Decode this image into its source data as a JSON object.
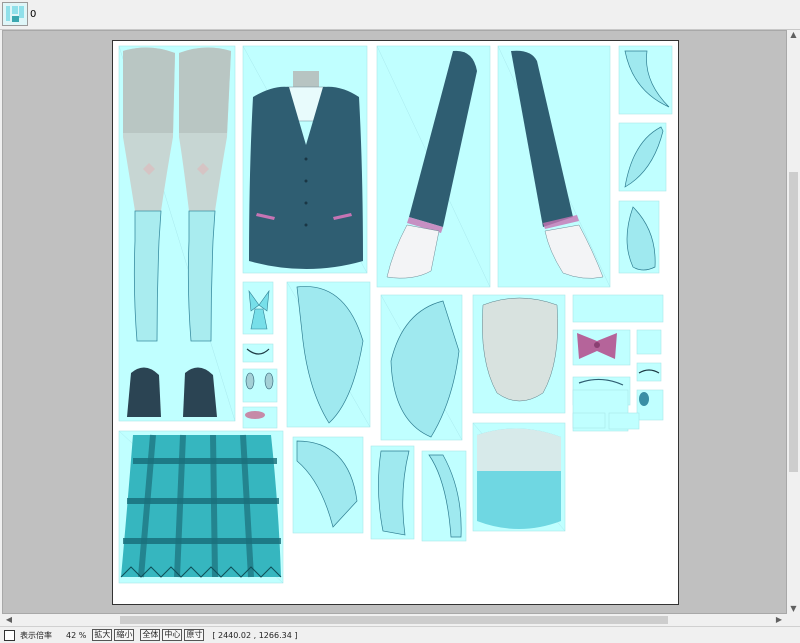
{
  "tab": {
    "label": "0"
  },
  "status": {
    "zoom_label": "表示倍率",
    "zoom_value": "42 %",
    "zoom_in": "拡大",
    "zoom_out": "縮小",
    "fit_all": "全体",
    "center": "中心",
    "actual_size": "原寸",
    "coords": "[ 2440.02 , 1266.34 ]"
  },
  "colors": {
    "panel": "#c0ffff",
    "jacket": "#2f5e72",
    "skirt": "#2aa3ad",
    "bow": "#b5649a"
  }
}
